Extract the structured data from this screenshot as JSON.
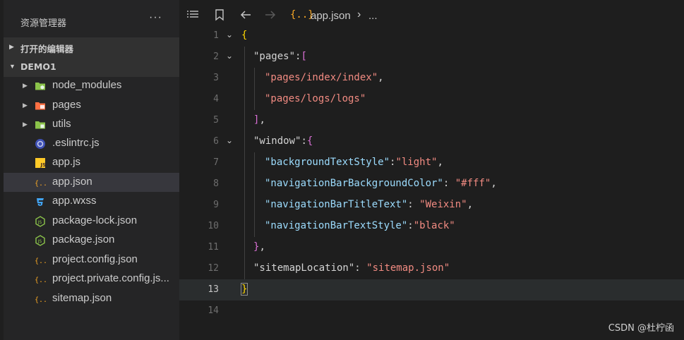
{
  "explorer": {
    "title": "资源管理器",
    "more": "···",
    "open_editors": "打开的编辑器",
    "project": "DEMO1",
    "items": [
      {
        "label": "node_modules",
        "icon": "folder-node-icon",
        "folder": true
      },
      {
        "label": "pages",
        "icon": "folder-pages-icon",
        "folder": true
      },
      {
        "label": "utils",
        "icon": "folder-utils-icon",
        "folder": true
      },
      {
        "label": ".eslintrc.js",
        "icon": "eslint-icon",
        "folder": false
      },
      {
        "label": "app.js",
        "icon": "js-file-icon",
        "folder": false
      },
      {
        "label": "app.json",
        "icon": "json-file-icon",
        "folder": false,
        "active": true
      },
      {
        "label": "app.wxss",
        "icon": "css-file-icon",
        "folder": false
      },
      {
        "label": "package-lock.json",
        "icon": "nodejs-file-icon",
        "folder": false
      },
      {
        "label": "package.json",
        "icon": "nodejs-file-icon",
        "folder": false
      },
      {
        "label": "project.config.json",
        "icon": "json-file-icon",
        "folder": false
      },
      {
        "label": "project.private.config.js...",
        "icon": "json-file-icon",
        "folder": false
      },
      {
        "label": "sitemap.json",
        "icon": "json-file-icon",
        "folder": false
      }
    ]
  },
  "breadcrumb": {
    "file_icon": "{..}",
    "file": "app.json",
    "separator": "›",
    "more": "..."
  },
  "editor": {
    "current_line": 13,
    "lines": [
      {
        "n": "1"
      },
      {
        "n": "2"
      },
      {
        "n": "3"
      },
      {
        "n": "4"
      },
      {
        "n": "5"
      },
      {
        "n": "6"
      },
      {
        "n": "7"
      },
      {
        "n": "8"
      },
      {
        "n": "9"
      },
      {
        "n": "10"
      },
      {
        "n": "11"
      },
      {
        "n": "12"
      },
      {
        "n": "13"
      },
      {
        "n": "14"
      }
    ],
    "tokens": {
      "l1_open": "{",
      "l2_key": "\"pages\"",
      "l2_colon": ":",
      "l2_open": "[",
      "l3_val": "\"pages/index/index\"",
      "l3_comma": ",",
      "l4_val": "\"pages/logs/logs\"",
      "l5_close": "]",
      "l5_comma": ",",
      "l6_key": "\"window\"",
      "l6_colon": ":",
      "l6_open": "{",
      "l7_key": "\"backgroundTextStyle\"",
      "l7_colon": ":",
      "l7_val": "\"light\"",
      "l7_comma": ",",
      "l8_key": "\"navigationBarBackgroundColor\"",
      "l8_colon": ": ",
      "l8_val": "\"#fff\"",
      "l8_comma": ",",
      "l9_key": "\"navigationBarTitleText\"",
      "l9_colon": ": ",
      "l9_val": "\"Weixin\"",
      "l9_comma": ",",
      "l10_key": "\"navigationBarTextStyle\"",
      "l10_colon": ":",
      "l10_val": "\"black\"",
      "l11_close": "}",
      "l11_comma": ",",
      "l12_key": "\"sitemapLocation\"",
      "l12_colon": ": ",
      "l12_val": "\"sitemap.json\"",
      "l13_close": "}"
    }
  },
  "watermark": "CSDN @杜柠函",
  "colors": {
    "sidebar_bg": "#252526",
    "editor_bg": "#1e1e1e",
    "active_row": "#37373d",
    "string": "#f28b82",
    "bracket_gold": "#ffd700",
    "bracket_purple": "#da70d6"
  }
}
